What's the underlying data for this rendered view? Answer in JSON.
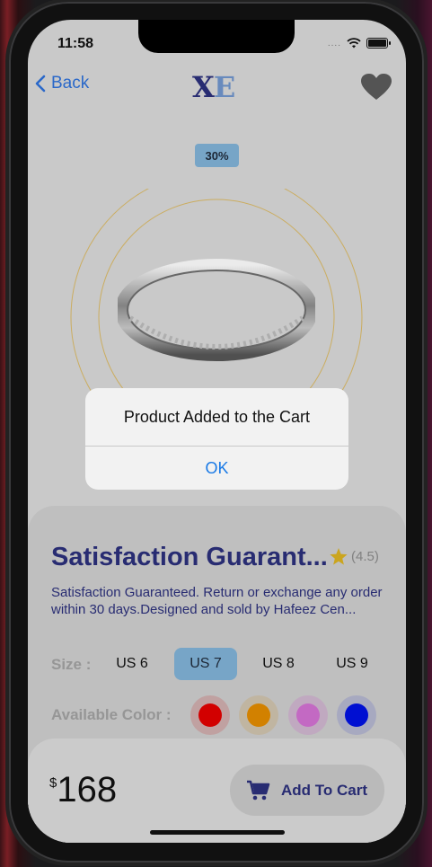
{
  "status": {
    "time": "11:58",
    "dots": "...."
  },
  "nav": {
    "back_label": "Back",
    "logo_x": "X",
    "logo_e": "E"
  },
  "product": {
    "discount": "30%",
    "title": "Satisfaction Guarant...",
    "rating": "(4.5)",
    "description": "Satisfaction Guaranteed. Return or exchange any order within 30 days.Designed and sold by Hafeez Cen..."
  },
  "sizes": {
    "label": "Size :",
    "options": [
      "US 6",
      "US 7",
      "US 8",
      "US 9"
    ],
    "selected": "US 7"
  },
  "colors": {
    "label": "Available Color :",
    "swatches": [
      "#e00000",
      "#e08a00",
      "#d070d0",
      "#0010e0"
    ]
  },
  "footer": {
    "currency": "$",
    "price": "168",
    "add_to_cart": "Add To Cart"
  },
  "dialog": {
    "title": "Product Added to the Cart",
    "ok": "OK"
  },
  "theme": {
    "accent": "#2b2f7a",
    "selected": "#7fb0d4",
    "link": "#1a7ae6"
  }
}
